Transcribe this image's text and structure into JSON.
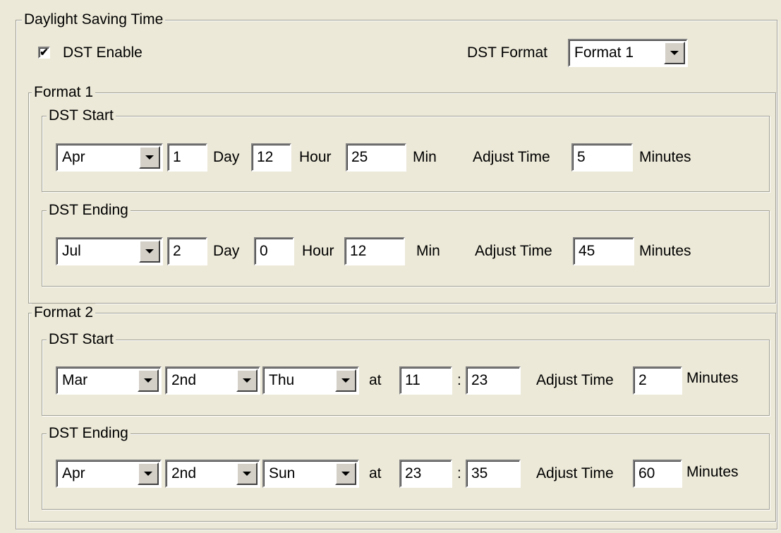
{
  "dst": {
    "group_title": "Daylight Saving Time",
    "enable_label": "DST Enable",
    "enable_checked": true,
    "check_glyph": "✔",
    "format_label": "DST Format",
    "format_value": "Format 1"
  },
  "format1": {
    "title": "Format 1",
    "start": {
      "title": "DST Start",
      "month": "Apr",
      "day": "1",
      "day_label": "Day",
      "hour": "12",
      "hour_label": "Hour",
      "min": "25",
      "min_label": "Min",
      "adjust_label": "Adjust Time",
      "adjust": "5",
      "minutes_label": "Minutes"
    },
    "ending": {
      "title": "DST Ending",
      "month": "Jul",
      "day": "2",
      "day_label": "Day",
      "hour": "0",
      "hour_label": "Hour",
      "min": "12",
      "min_label": "Min",
      "adjust_label": "Adjust Time",
      "adjust": "45",
      "minutes_label": "Minutes"
    }
  },
  "format2": {
    "title": "Format 2",
    "start": {
      "title": "DST Start",
      "month": "Mar",
      "week": "2nd",
      "weekday": "Thu",
      "at_label": "at",
      "hour": "11",
      "colon": ":",
      "min": "23",
      "adjust_label": "Adjust Time",
      "adjust": "2",
      "minutes_label": "Minutes"
    },
    "ending": {
      "title": "DST Ending",
      "month": "Apr",
      "week": "2nd",
      "weekday": "Sun",
      "at_label": "at",
      "hour": "23",
      "colon": ":",
      "min": "35",
      "adjust_label": "Adjust Time",
      "adjust": "60",
      "minutes_label": "Minutes"
    }
  }
}
